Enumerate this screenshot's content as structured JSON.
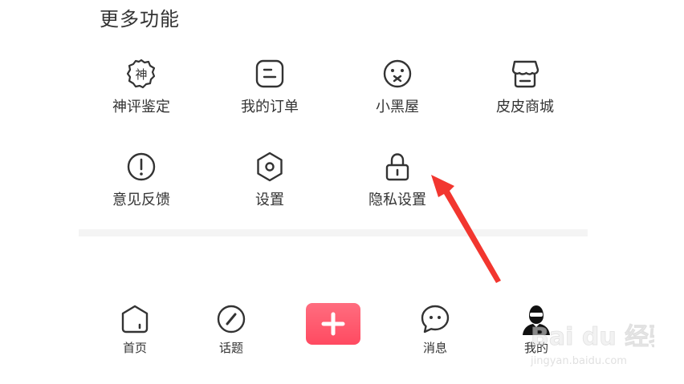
{
  "section": {
    "title": "更多功能"
  },
  "features": {
    "row1": [
      {
        "label": "神评鉴定",
        "icon": "shen-badge-icon",
        "icon_glyph": "神"
      },
      {
        "label": "我的订单",
        "icon": "order-icon"
      },
      {
        "label": "小黑屋",
        "icon": "sealed-face-icon"
      },
      {
        "label": "皮皮商城",
        "icon": "shop-icon"
      }
    ],
    "row2": [
      {
        "label": "意见反馈",
        "icon": "exclamation-icon"
      },
      {
        "label": "设置",
        "icon": "hexagon-settings-icon"
      },
      {
        "label": "隐私设置",
        "icon": "lock-icon"
      }
    ]
  },
  "tabbar": {
    "home": {
      "label": "首页",
      "icon": "home-icon"
    },
    "topics": {
      "label": "话题",
      "icon": "compass-icon"
    },
    "add": {
      "icon": "plus-icon"
    },
    "messages": {
      "label": "消息",
      "icon": "chat-bubble-icon"
    },
    "me": {
      "label": "我的",
      "icon": "avatar-icon"
    }
  },
  "colors": {
    "text": "#333333",
    "icon_stroke": "#333333",
    "accent": "#ff5a6e",
    "annotation_arrow": "#f2362f",
    "divider": "#f4f4f4"
  },
  "watermark": {
    "brand": "Bai du 经验",
    "url": "jingyan.baidu.com"
  }
}
